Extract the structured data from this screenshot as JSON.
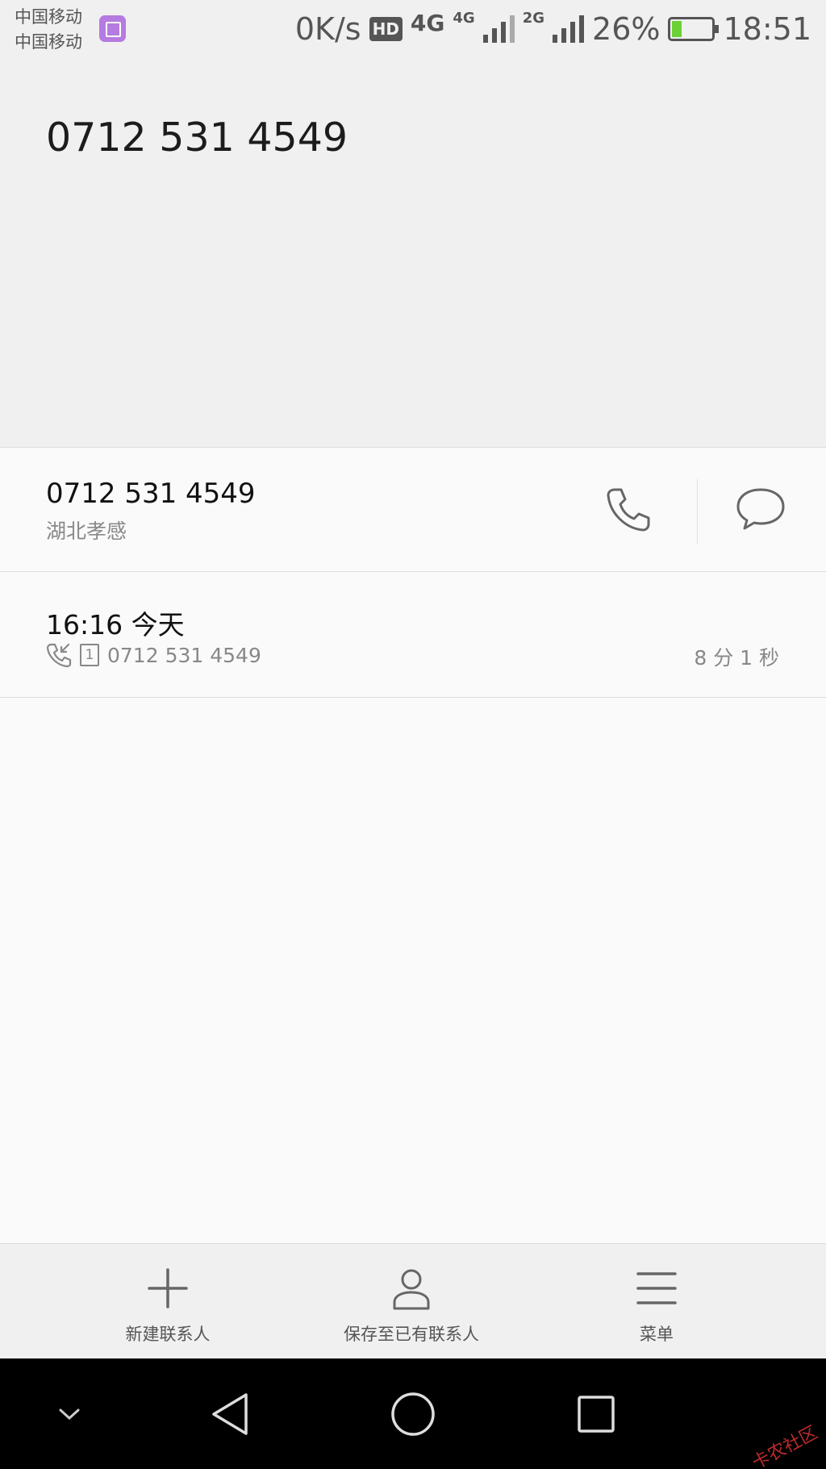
{
  "status_bar": {
    "carrier_1": "中国移动",
    "carrier_2": "中国移动",
    "net_speed": "0K/s",
    "hd": "HD",
    "network_1": "4G",
    "network_2": "4G",
    "network_3": "2G",
    "battery": "26%",
    "time": "18:51",
    "battery_level": 0.26,
    "battery_color": "#6cd137"
  },
  "header": {
    "number": "0712 531 4549"
  },
  "contact": {
    "number": "0712 531 4549",
    "location": "湖北孝感",
    "call_icon": "phone-icon",
    "message_icon": "message-bubble-icon"
  },
  "call_log": {
    "time": "16:16 今天",
    "sim": "1",
    "number": "0712 531 4549",
    "duration": "8 分 1 秒",
    "type_icon": "incoming-call-icon"
  },
  "actions": {
    "new_contact": "新建联系人",
    "save_existing": "保存至已有联系人",
    "menu": "菜单"
  },
  "watermark": "卡农社区"
}
